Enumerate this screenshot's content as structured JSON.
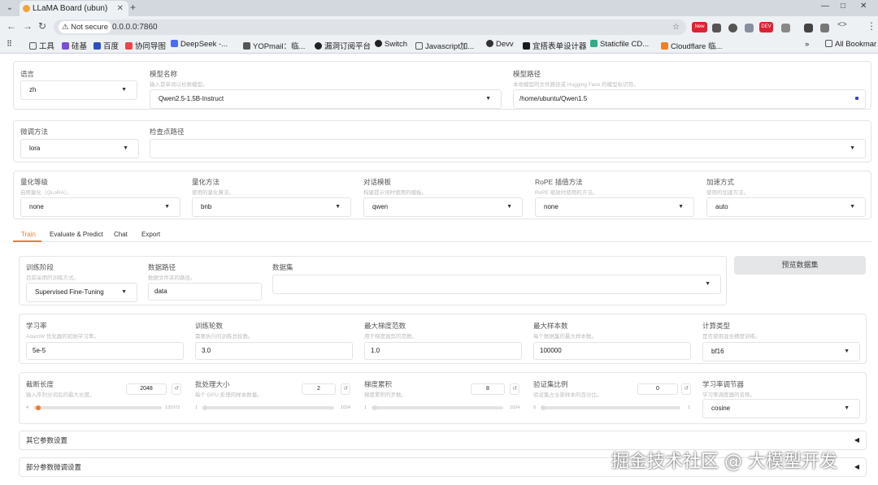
{
  "browser": {
    "tab_title": "LLaMA Board (ubun)",
    "security_label": "Not secure",
    "url": "0.0.0.0:7860",
    "bookmarks": [
      "工具",
      "硅基",
      "百度",
      "协同导图",
      "DeepSeek -...",
      "YOPmail：临...",
      "漏洞订阅平台",
      "Switch",
      "Javascript加...",
      "Devv",
      "宜搭表单设计器",
      "Staticfile CD...",
      "Cloudflare 临..."
    ],
    "all_bookmarks": "All Bookmar",
    "ext_new": "New",
    "ext_dev": "DEV"
  },
  "top": {
    "lang_label": "语言",
    "lang_value": "zh",
    "model_name_label": "模型名称",
    "model_name_info": "输入首单词以检索模型。",
    "model_name_value": "Qwen2.5-1.5B-Instruct",
    "model_path_label": "模型路径",
    "model_path_info": "本地模型的文件路径或 Hugging Face 的模型标识符。",
    "model_path_value": "/home/ubuntu/Qwen1.5",
    "finetune_label": "微调方法",
    "finetune_value": "lora",
    "checkpoint_label": "检查点路径",
    "checkpoint_value": "",
    "quant_bit_label": "量化等级",
    "quant_bit_info": "启用量化（QLoRA）。",
    "quant_bit_value": "none",
    "quant_method_label": "量化方法",
    "quant_method_info": "使用的量化算法。",
    "quant_method_value": "bnb",
    "template_label": "对话模板",
    "template_info": "构建提示词时使用的模板。",
    "template_value": "qwen",
    "rope_label": "RoPE 插值方法",
    "rope_info": "RoPE 缩放时使用的方法。",
    "rope_value": "none",
    "booster_label": "加速方式",
    "booster_info": "使用的加速方法。",
    "booster_value": "auto"
  },
  "tabs": [
    "Train",
    "Evaluate & Predict",
    "Chat",
    "Export"
  ],
  "train": {
    "stage_label": "训练阶段",
    "stage_info": "目前采用的训练方式。",
    "stage_value": "Supervised Fine-Tuning",
    "dataset_dir_label": "数据路径",
    "dataset_dir_info": "数据文件夹的路径。",
    "dataset_dir_value": "data",
    "dataset_label": "数据集",
    "dataset_value": "",
    "preview_button": "预览数据集",
    "lr_label": "学习率",
    "lr_info": "AdamW 优化器的初始学习率。",
    "lr_value": "5e-5",
    "epochs_label": "训练轮数",
    "epochs_info": "需要执行的训练总轮数。",
    "epochs_value": "3.0",
    "maxgrad_label": "最大梯度范数",
    "maxgrad_info": "用于梯度裁剪的范数。",
    "maxgrad_value": "1.0",
    "maxsamples_label": "最大样本数",
    "maxsamples_info": "每个数据集的最大样本数。",
    "maxsamples_value": "100000",
    "compute_label": "计算类型",
    "compute_info": "是否使用混合精度训练。",
    "compute_value": "bf16",
    "cutoff_label": "截断长度",
    "cutoff_info": "输入序列分词后的最大长度。",
    "cutoff_value": "2048",
    "cutoff_min": "4",
    "cutoff_max": "131072",
    "batch_label": "批处理大小",
    "batch_info": "每个 GPU 处理的样本数量。",
    "batch_value": "2",
    "batch_min": "1",
    "batch_max": "1024",
    "gradacc_label": "梯度累积",
    "gradacc_info": "梯度累积的步数。",
    "gradacc_value": "8",
    "gradacc_min": "1",
    "gradacc_max": "1024",
    "valsize_label": "验证集比例",
    "valsize_info": "验证集占全部样本的百分比。",
    "valsize_value": "0",
    "valsize_min": "0",
    "valsize_max": "1",
    "scheduler_label": "学习率调节器",
    "scheduler_info": "学习率调度器的名称。",
    "scheduler_value": "cosine",
    "sliders": {
      "cutoff": 0.02,
      "batch": 0.001,
      "gradacc": 0.007,
      "valsize": 0
    }
  },
  "accordions": [
    "其它参数设置",
    "部分参数微调设置"
  ],
  "watermark": "掘金技术社区 @ 大模型开发",
  "colors": {
    "accent": "#f07a2a",
    "link_dot": "#3344cc"
  }
}
